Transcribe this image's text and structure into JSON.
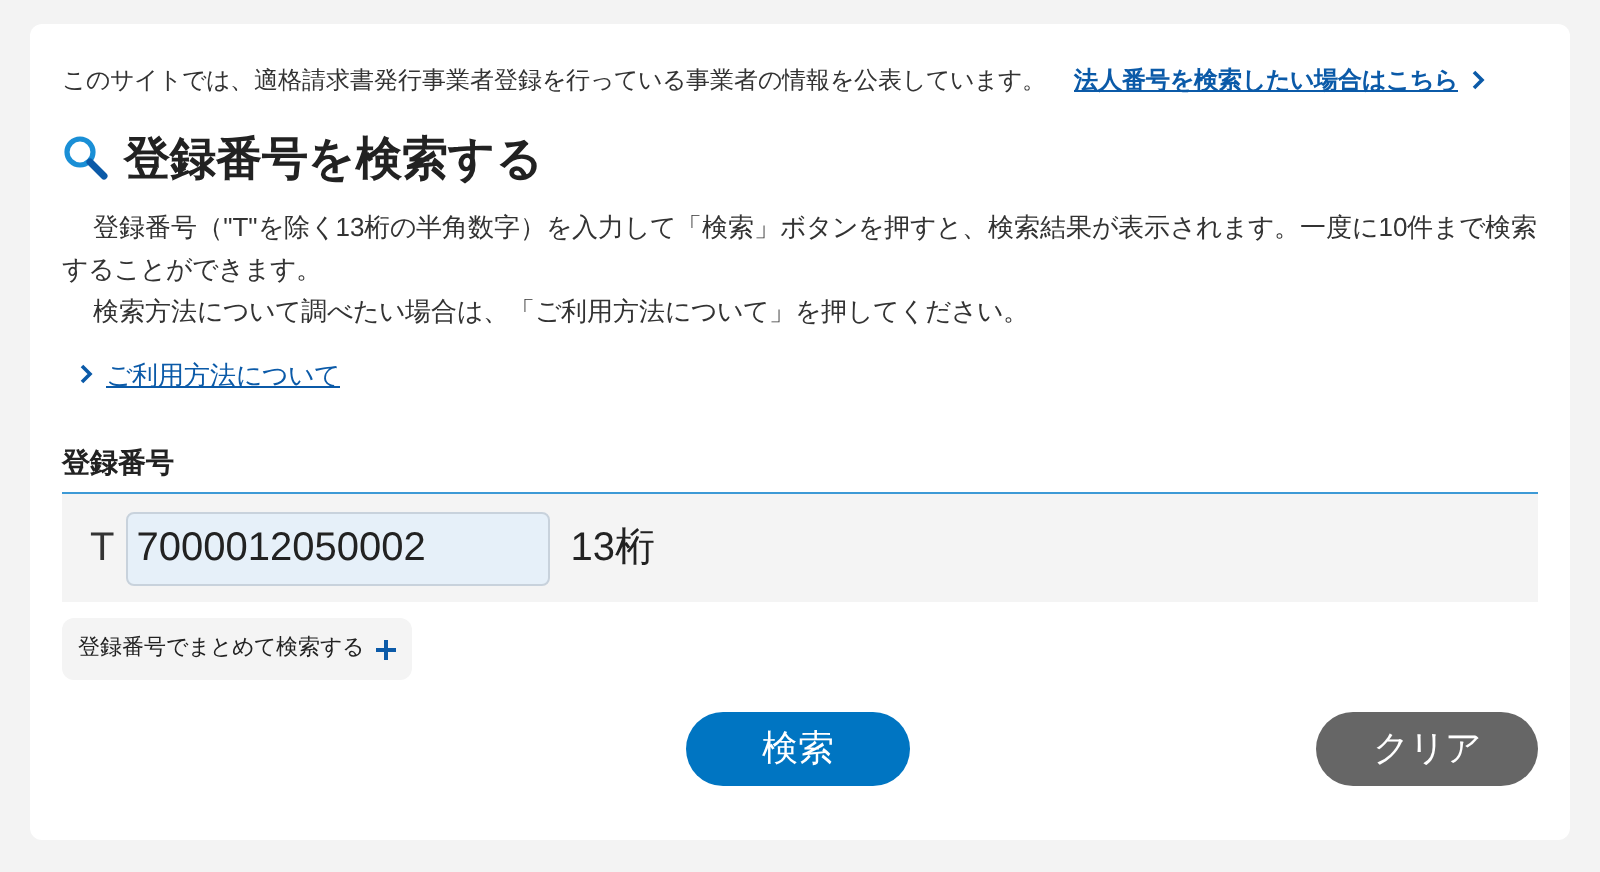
{
  "notice": {
    "text": "このサイトでは、適格請求書発行事業者登録を行っている事業者の情報を公表しています。",
    "link": "法人番号を検索したい場合はこちら"
  },
  "heading": "登録番号を検索する",
  "paragraphs": [
    "登録番号（\"T\"を除く13桁の半角数字）を入力して「検索」ボタンを押すと、検索結果が表示されます。一度に10件まで検索することができます。",
    "検索方法について調べたい場合は、「ご利用方法について」を押してください。"
  ],
  "help_link": "ご利用方法について",
  "field": {
    "label": "登録番号",
    "prefix": "T",
    "value": "7000012050002",
    "suffix": "13桁"
  },
  "bulk_toggle": {
    "label": "登録番号でまとめて検索する",
    "expanded": false
  },
  "buttons": [
    {
      "kind": "primary",
      "label": "検索"
    },
    {
      "kind": "secondary",
      "label": "クリア"
    }
  ]
}
